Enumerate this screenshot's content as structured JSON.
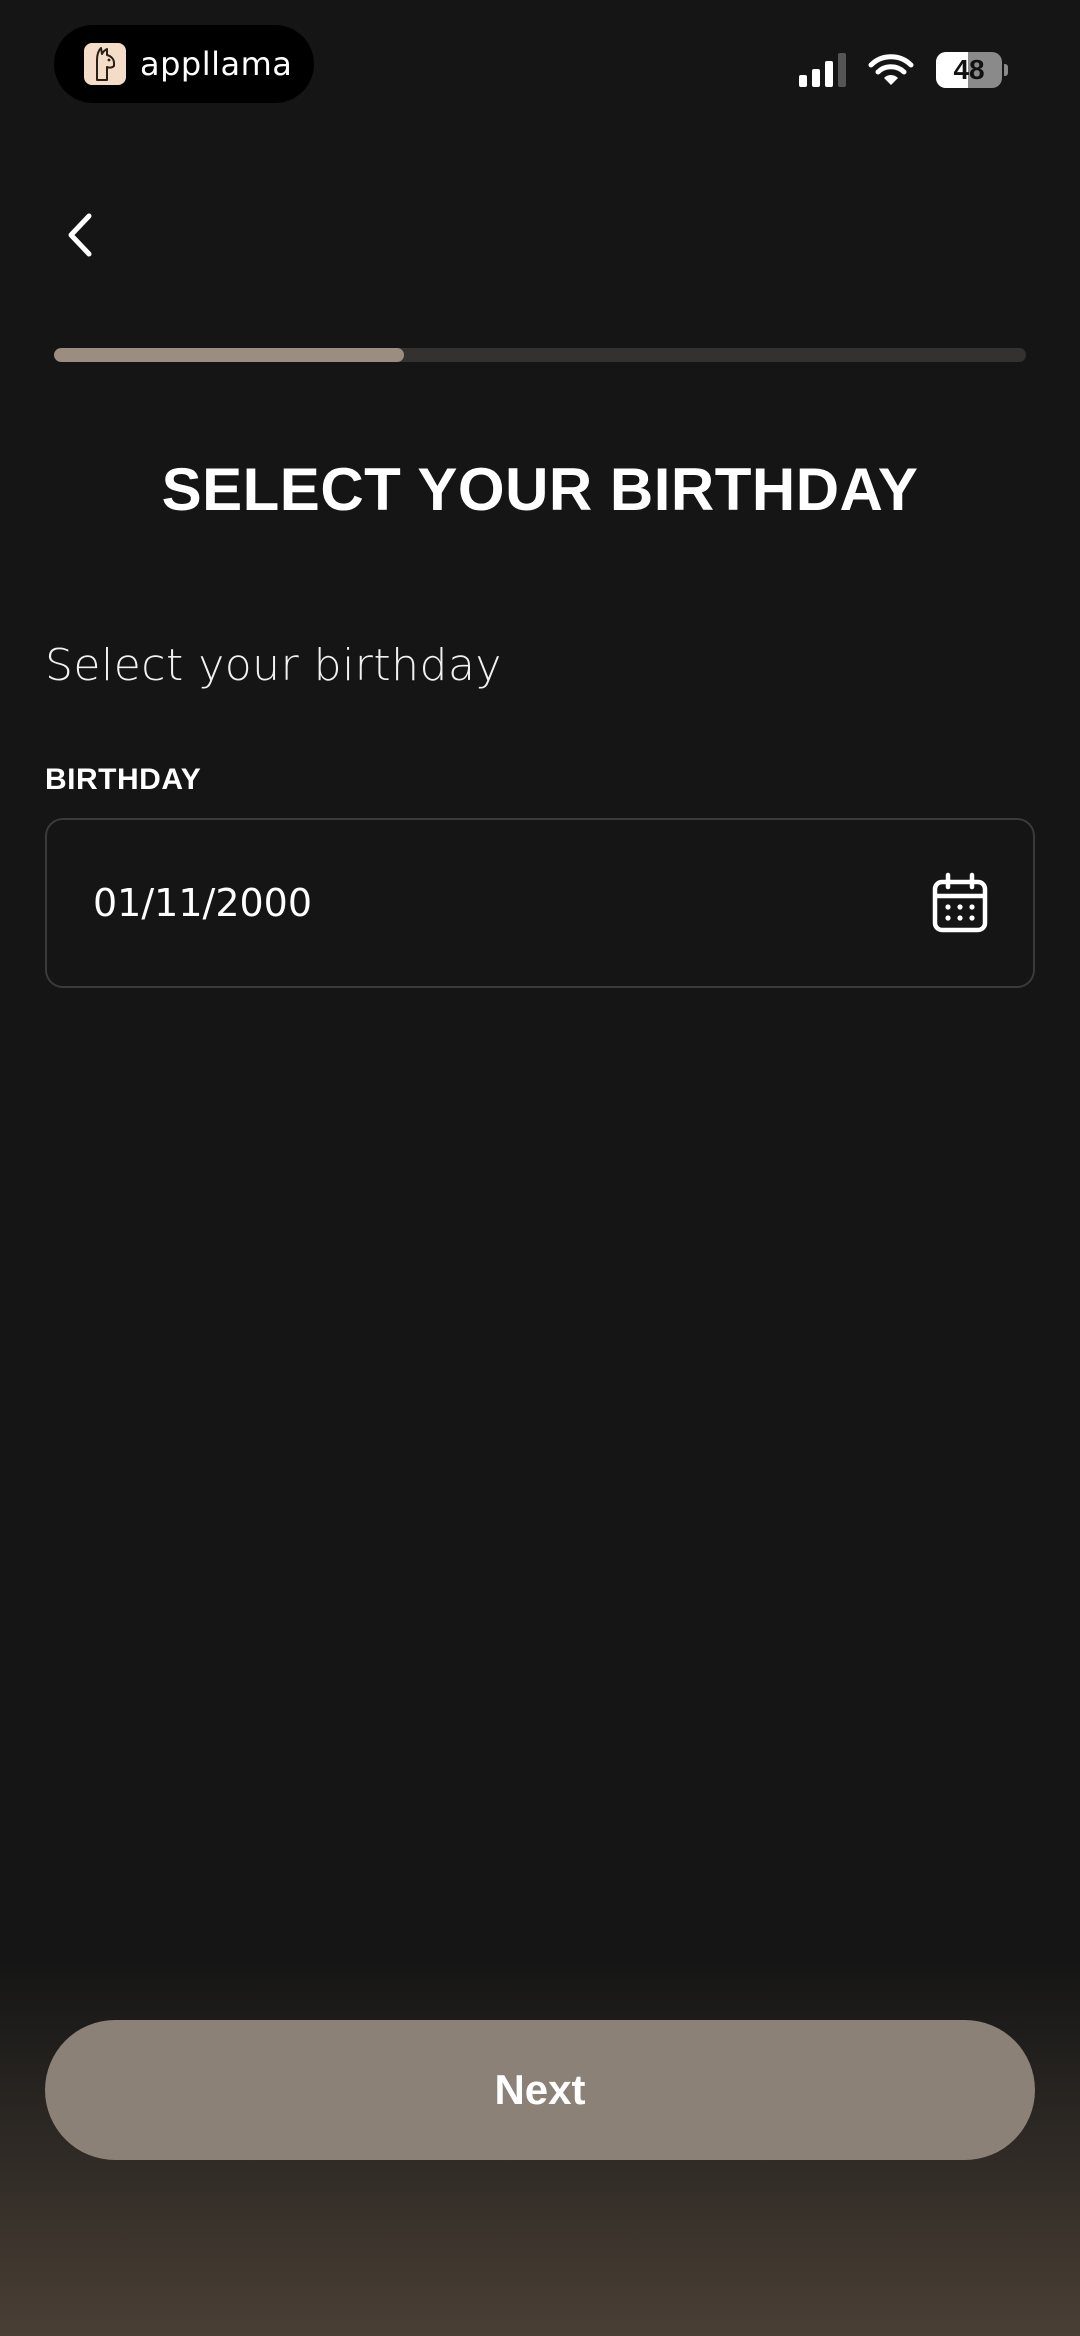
{
  "status_bar": {
    "app_name": "appllama",
    "battery_level": "48",
    "battery_fraction": 0.48,
    "signal_bars_active": 3,
    "icons": [
      "llama-logo-icon",
      "signal-icon",
      "wifi-icon",
      "battery-icon"
    ]
  },
  "nav": {
    "back_icon": "chevron-left-icon"
  },
  "progress": {
    "fraction": 0.36
  },
  "page": {
    "title": "SELECT YOUR BIRTHDAY",
    "subtitle": "Select your birthday"
  },
  "birthday_field": {
    "label": "BIRTHDAY",
    "value": "01/11/2000",
    "icon": "calendar-icon"
  },
  "footer": {
    "next_label": "Next"
  },
  "colors": {
    "background": "#151515",
    "accent": "#9b8e80",
    "button": "#8b8177",
    "border": "#3a3a3a"
  }
}
